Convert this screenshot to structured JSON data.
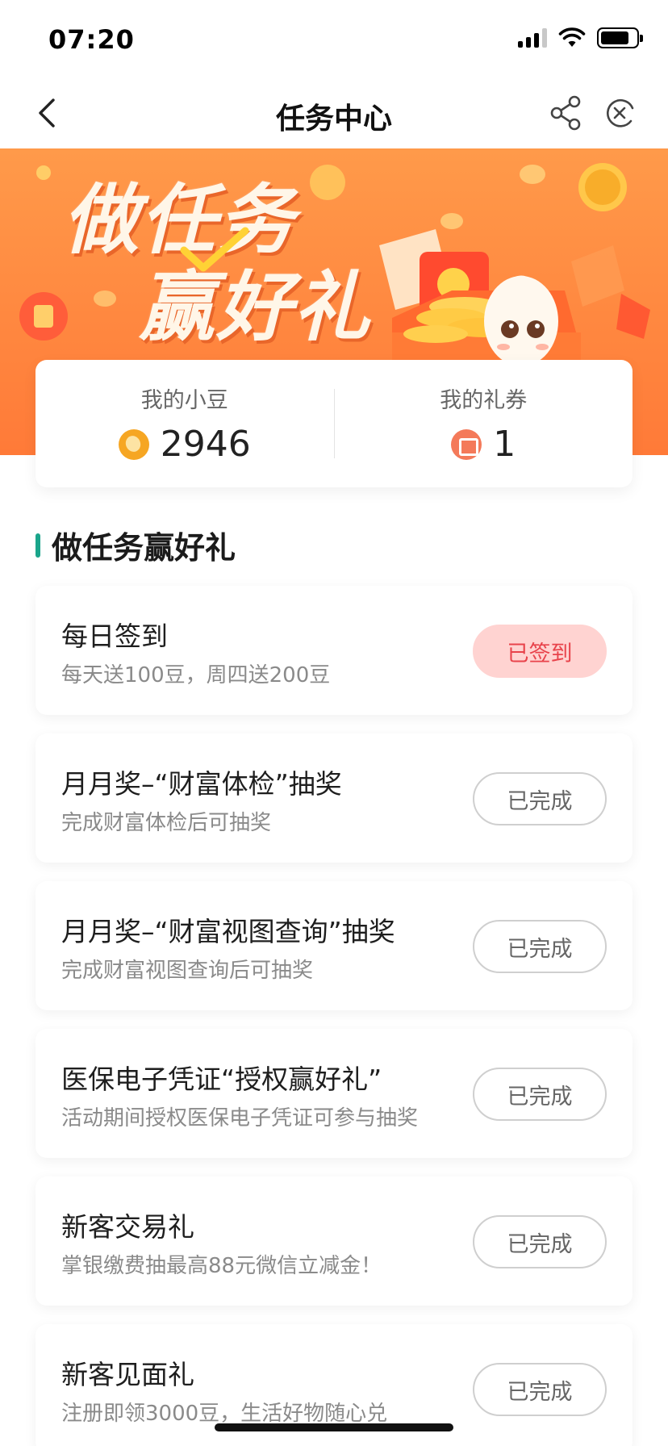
{
  "status_bar": {
    "time": "07:20"
  },
  "nav": {
    "title": "任务中心",
    "back_icon": "chevron-left-icon",
    "share_icon": "share-icon",
    "close_icon": "close-circle-icon"
  },
  "banner": {
    "title_line1": "做任务",
    "title_line2": "赢好礼",
    "colors": {
      "bg": "#ff8840",
      "text": "#fff6e8"
    }
  },
  "summary": {
    "beans": {
      "label": "我的小豆",
      "value": "2946",
      "icon": "bean-coin-icon"
    },
    "coupons": {
      "label": "我的礼券",
      "value": "1",
      "icon": "coupon-icon"
    }
  },
  "section": {
    "title": "做任务赢好礼",
    "accent_color": "#1aa58b"
  },
  "tasks": [
    {
      "name": "每日签到",
      "desc": "每天送100豆，周四送200豆",
      "button": "已签到",
      "state": "signed"
    },
    {
      "name": "月月奖–“财富体检”抽奖",
      "desc": "完成财富体检后可抽奖",
      "button": "已完成",
      "state": "done"
    },
    {
      "name": "月月奖–“财富视图查询”抽奖",
      "desc": "完成财富视图查询后可抽奖",
      "button": "已完成",
      "state": "done"
    },
    {
      "name": "医保电子凭证“授权赢好礼”",
      "desc": "活动期间授权医保电子凭证可参与抽奖",
      "button": "已完成",
      "state": "done"
    },
    {
      "name": "新客交易礼",
      "desc": "掌银缴费抽最高88元微信立减金！",
      "button": "已完成",
      "state": "done"
    },
    {
      "name": "新客见面礼",
      "desc": "注册即领3000豆，生活好物随心兑",
      "button": "已完成",
      "state": "done"
    }
  ]
}
